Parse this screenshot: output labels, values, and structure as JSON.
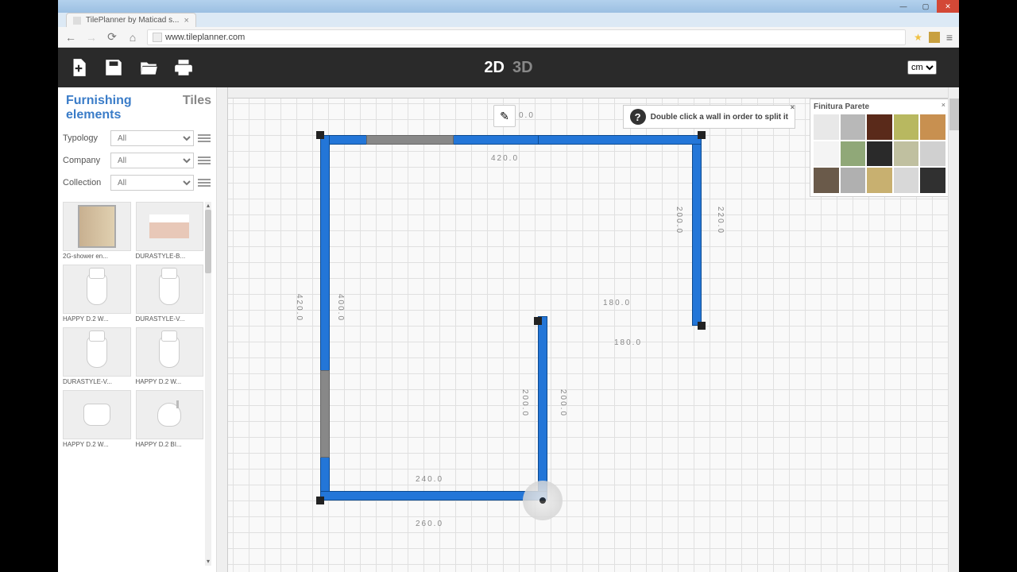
{
  "window": {
    "tab_title": "TilePlanner by Maticad s...",
    "url": "www.tileplanner.com"
  },
  "toolbar": {
    "view_2d": "2D",
    "view_3d": "3D",
    "unit": "cm"
  },
  "sidebar": {
    "tabs": {
      "furnishing": "Furnishing elements",
      "tiles": "Tiles"
    },
    "filters": {
      "typology": {
        "label": "Typology",
        "value": "All"
      },
      "company": {
        "label": "Company",
        "value": "All"
      },
      "collection": {
        "label": "Collection",
        "value": "All"
      }
    },
    "items": [
      {
        "label": "2G-shower en..."
      },
      {
        "label": "DURASTYLE-B..."
      },
      {
        "label": "HAPPY D.2 W..."
      },
      {
        "label": "DURASTYLE-V..."
      },
      {
        "label": "DURASTYLE-V..."
      },
      {
        "label": "HAPPY D.2 W..."
      },
      {
        "label": "HAPPY D.2 W..."
      },
      {
        "label": "HAPPY D.2 BI..."
      }
    ]
  },
  "canvas": {
    "hint": "Double click a wall in order to split it",
    "pencil_dim": "0.0",
    "dims": {
      "top_outer": "420.0",
      "left_outer": "420.0",
      "left_inner": "400.0",
      "right_upper_outer": "220.0",
      "right_upper_inner": "200.0",
      "mid_right": "180.0",
      "mid_right_below": "180.0",
      "notch_v_inner": "200.0",
      "notch_v_outer": "200.0",
      "bottom_inner": "240.0",
      "bottom_outer": "260.0"
    }
  },
  "palette": {
    "title": "Finitura Parete",
    "colors": [
      "#e8e8e8",
      "#b8b8b8",
      "#5a2a1a",
      "#b8b860",
      "#c89050",
      "#f4f4f4",
      "#90a878",
      "#2a2a2a",
      "#c0c0a0",
      "#d0d0d0",
      "#6a5a4a",
      "#b0b0b0",
      "#c8b070",
      "#d8d8d8",
      "#303030"
    ]
  }
}
